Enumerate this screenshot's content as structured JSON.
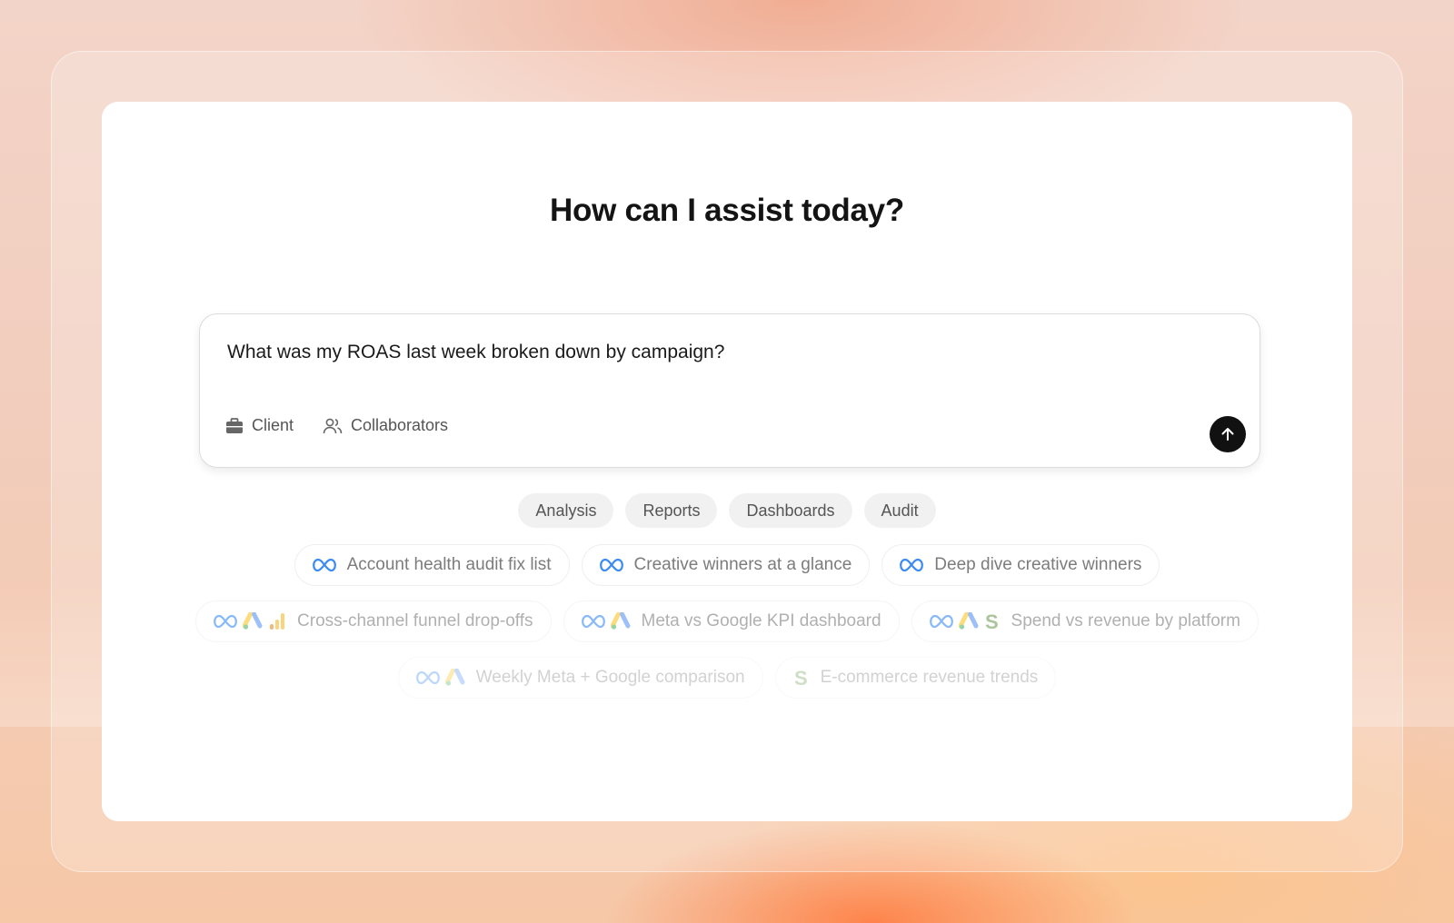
{
  "heading": "How can I assist today?",
  "composer": {
    "prompt": "What was my ROAS last week broken down by campaign?",
    "client_label": "Client",
    "collaborators_label": "Collaborators"
  },
  "tabs": [
    "Analysis",
    "Reports",
    "Dashboards",
    "Audit"
  ],
  "suggestions": {
    "row1": [
      {
        "label": "Account health audit fix list",
        "icons": [
          "meta-icon"
        ]
      },
      {
        "label": "Creative winners at a glance",
        "icons": [
          "meta-icon"
        ]
      },
      {
        "label": "Deep dive creative winners",
        "icons": [
          "meta-icon"
        ]
      }
    ],
    "row2": [
      {
        "label": "Cross-channel funnel drop-offs",
        "icons": [
          "meta-icon",
          "google-ads-icon",
          "analytics-icon"
        ]
      },
      {
        "label": "Meta vs Google KPI dashboard",
        "icons": [
          "meta-icon",
          "google-ads-icon"
        ]
      },
      {
        "label": "Spend vs revenue by platform",
        "icons": [
          "meta-icon",
          "google-ads-icon",
          "shopify-icon"
        ]
      }
    ],
    "row3": [
      {
        "label": "Weekly Meta + Google comparison",
        "icons": [
          "meta-icon",
          "google-ads-icon"
        ]
      },
      {
        "label": "E-commerce revenue trends",
        "icons": [
          "shopify-icon"
        ]
      }
    ]
  },
  "colors": {
    "send_button": "#111111",
    "meta_blue": "#1877f2",
    "tab_bg": "#f1f1f1"
  }
}
